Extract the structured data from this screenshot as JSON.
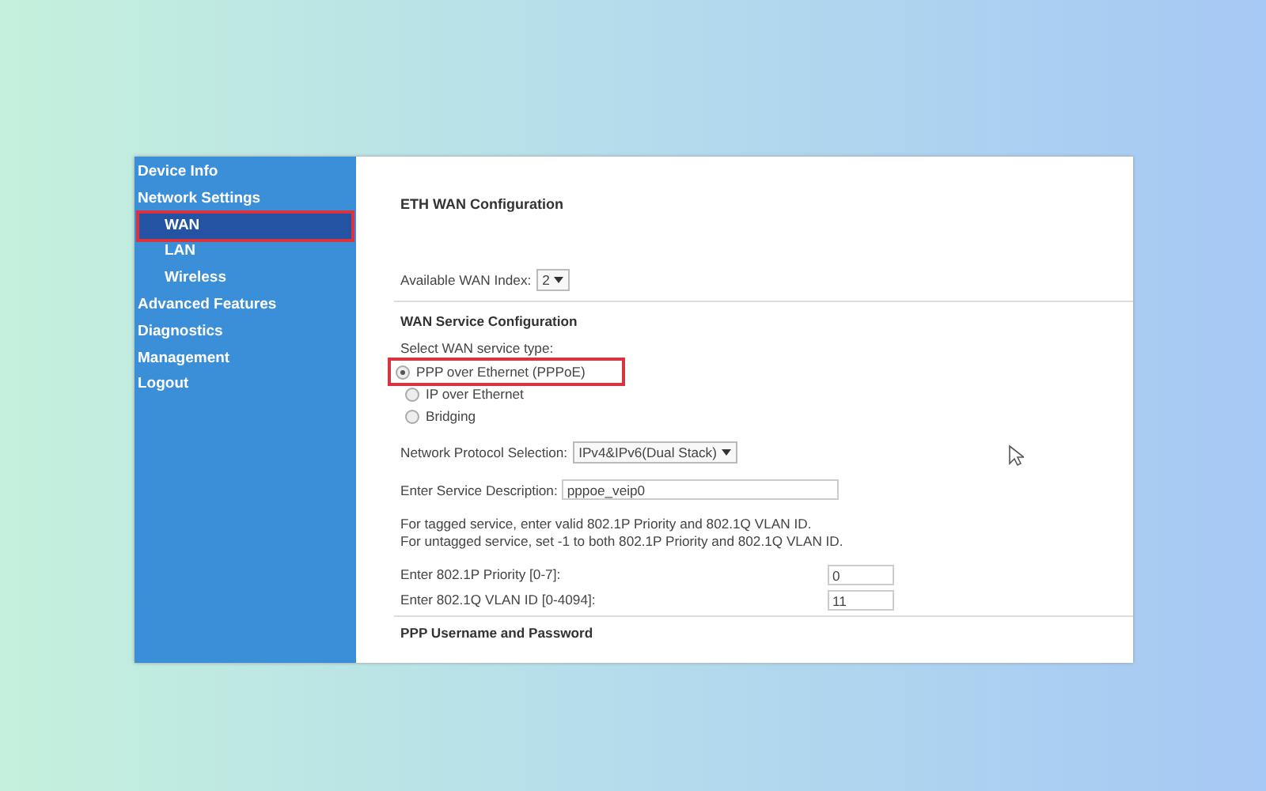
{
  "sidebar": {
    "items": [
      {
        "label": "Device Info",
        "selected": false,
        "highlighted": false
      },
      {
        "label": "Network Settings",
        "selected": false,
        "highlighted": false,
        "children": [
          {
            "label": "WAN",
            "selected": true,
            "highlighted": true
          },
          {
            "label": "LAN",
            "selected": false,
            "highlighted": false
          },
          {
            "label": "Wireless",
            "selected": false,
            "highlighted": false
          }
        ]
      },
      {
        "label": "Advanced Features",
        "selected": false,
        "highlighted": false
      },
      {
        "label": "Diagnostics",
        "selected": false,
        "highlighted": false
      },
      {
        "label": "Management",
        "selected": false,
        "highlighted": false
      },
      {
        "label": "Logout",
        "selected": false,
        "highlighted": false
      }
    ]
  },
  "content": {
    "title": "ETH WAN Configuration",
    "wan_index": {
      "label": "Available WAN Index:",
      "value": "2"
    },
    "section": "WAN Service Configuration",
    "service_type": {
      "label": "Select WAN service type:",
      "options": [
        {
          "label": "PPP over Ethernet (PPPoE)",
          "selected": true,
          "highlighted": true
        },
        {
          "label": "IP over Ethernet",
          "selected": false,
          "highlighted": false
        },
        {
          "label": "Bridging",
          "selected": false,
          "highlighted": false
        }
      ]
    },
    "protocol": {
      "label": "Network Protocol Selection:",
      "value": "IPv4&IPv6(Dual Stack)"
    },
    "description": {
      "label": "Enter Service Description:",
      "value": "pppoe_veip0"
    },
    "notes": [
      "For tagged service, enter valid 802.1P Priority and 802.1Q VLAN ID.",
      "For untagged service, set -1 to both 802.1P Priority and 802.1Q VLAN ID."
    ],
    "fields": [
      {
        "label": "Enter 802.1P Priority [0-7]:",
        "value": "0"
      },
      {
        "label": "Enter 802.1Q VLAN ID [0-4094]:",
        "value": "11"
      }
    ],
    "footer_section": "PPP Username and Password"
  }
}
